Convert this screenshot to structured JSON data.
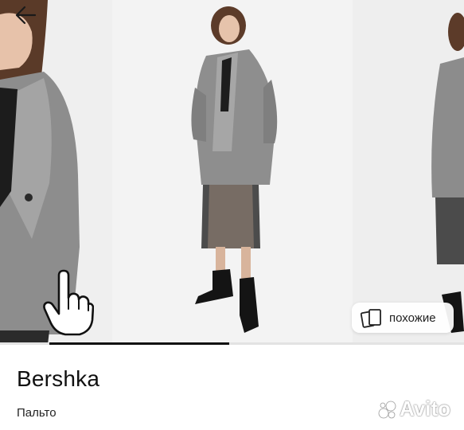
{
  "gallery": {
    "photos": [
      {
        "icon": "coat-model-closeup"
      },
      {
        "icon": "coat-model-full"
      },
      {
        "icon": "coat-model-side"
      }
    ],
    "back_icon": "arrow-left-icon",
    "swipe_hint_icon": "hand-pointer-icon",
    "similar_button": {
      "icon": "cards-icon",
      "label": "похожие"
    },
    "progress_fraction": 0.39
  },
  "listing": {
    "brand": "Bershka",
    "category": "Пальто"
  },
  "watermark": {
    "text": "Avito"
  },
  "colors": {
    "accent": "#111111",
    "background": "#f1f1f1"
  }
}
